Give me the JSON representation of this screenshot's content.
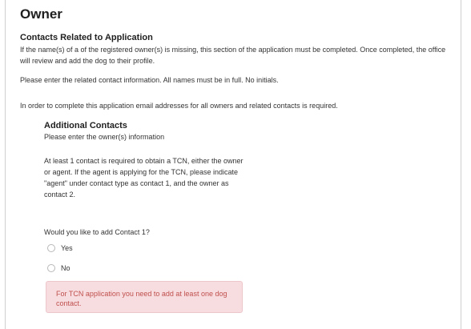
{
  "page": {
    "title": "Owner"
  },
  "contacts_section": {
    "title": "Contacts Related to Application",
    "paragraph_1": "If the name(s) of a of the registered owner(s) is missing, this section of the application must be completed. Once completed, the office will review and add the dog to their profile.",
    "paragraph_2": "Please enter the related contact information. All names must be in full. No initials.",
    "paragraph_3": "In order to complete this application email addresses for all owners and related contacts is required."
  },
  "additional_contacts": {
    "title": "Additional Contacts",
    "description": "Please enter the owner(s) information",
    "note": "At least 1 contact is required to obtain a TCN, either the owner or agent. If the agent is applying for the TCN, please indicate \"agent\" under contact type as contact 1, and the owner as contact 2.",
    "question": "Would you like to add Contact 1?",
    "options": [
      {
        "label": "Yes",
        "selected": false
      },
      {
        "label": "No",
        "selected": false
      }
    ],
    "error_message": "For TCN application you need to add at least one dog contact."
  },
  "colors": {
    "error_background": "#f7dde0",
    "error_text": "#c0504d"
  }
}
